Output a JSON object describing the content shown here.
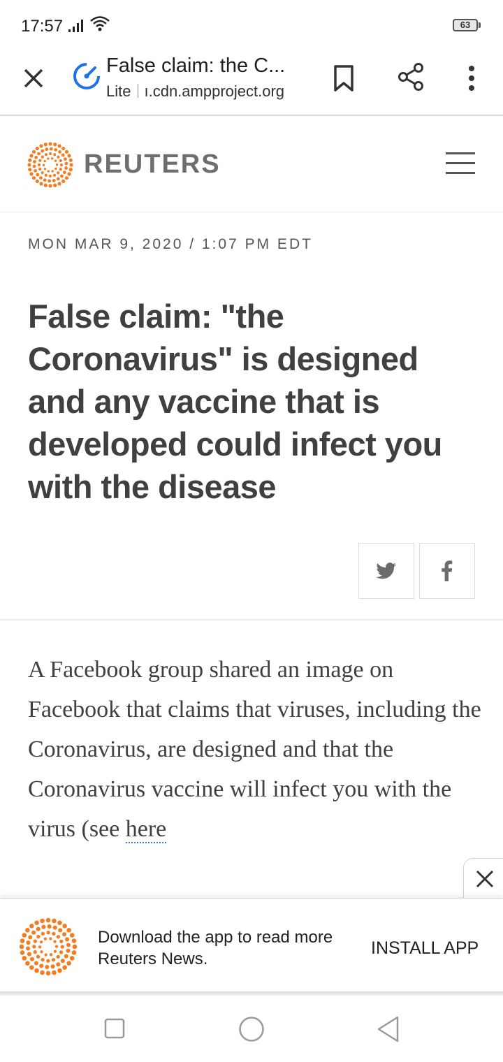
{
  "status_bar": {
    "time": "17:57",
    "battery": "63"
  },
  "browser": {
    "title": "False claim: the C...",
    "lite_label": "Lite",
    "domain": "ı.cdn.ampproject.org"
  },
  "site": {
    "logo_text": "REUTERS",
    "brand_color": "#f47c20"
  },
  "article": {
    "dateline": "MON MAR 9, 2020 / 1:07 PM EDT",
    "headline": "False claim: \"the Coronavirus\" is designed and any vaccine that is developed could infect you with the disease",
    "body": "A Facebook group shared an image on Facebook that claims that viruses, including the Coronavirus, are designed and that the Coronavirus vaccine will infect you with the virus (see ",
    "body_link": "here"
  },
  "banner": {
    "message": "Download the app to read more Reuters News.",
    "install_label": "INSTALL APP"
  },
  "icons": {
    "close": "close-icon",
    "lite": "lite-mode-icon",
    "bookmark": "bookmark-icon",
    "share": "share-icon",
    "more": "more-vert-icon",
    "menu": "hamburger-menu-icon",
    "twitter": "twitter-icon",
    "facebook": "facebook-icon"
  }
}
